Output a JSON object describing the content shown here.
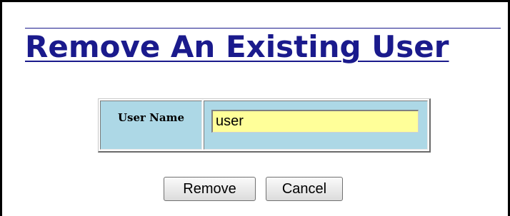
{
  "page": {
    "title": "Remove An Existing User"
  },
  "form": {
    "user_name_label": "User Name",
    "user_name_value": "user"
  },
  "buttons": {
    "remove_label": "Remove",
    "cancel_label": "Cancel"
  },
  "colors": {
    "title": "#1a1a8c",
    "label_cell_bg": "#add8e6",
    "input_bg": "#ffff99"
  }
}
